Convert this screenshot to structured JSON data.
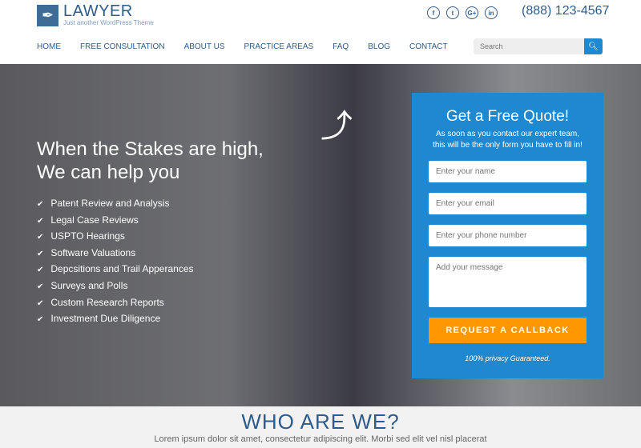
{
  "brand": {
    "title": "LAWYER",
    "tagline": "Just another WordPress Theme",
    "icon": "feather-icon"
  },
  "social": [
    {
      "icon": "facebook-icon",
      "glyph": "f"
    },
    {
      "icon": "twitter-icon",
      "glyph": "t"
    },
    {
      "icon": "google-plus-icon",
      "glyph": "G+"
    },
    {
      "icon": "linkedin-icon",
      "glyph": "in"
    }
  ],
  "phone": "(888) 123-4567",
  "nav": [
    "HOME",
    "FREE CONSULTATION",
    "ABOUT US",
    "PRACTICE AREAS",
    "FAQ",
    "BLOG",
    "CONTACT"
  ],
  "search": {
    "placeholder": "Search",
    "icon": "search-icon"
  },
  "hero": {
    "headline_1": "When the Stakes are high,",
    "headline_2": "We can help you",
    "list": [
      "Patent Review and Analysis",
      "Legal Case Reviews",
      "USPTO Hearings",
      "Software Valuations",
      "Depcsitions and Trail Apperances",
      "Surveys and Polls",
      "Custom Research Reports",
      "Investment Due Diligence"
    ]
  },
  "quote": {
    "title": "Get a Free Quote!",
    "sub_1": "As soon as you contact our expert team,",
    "sub_2": "this will be the only form you have to fill in!",
    "name_ph": "Enter your name",
    "email_ph": "Enter your email",
    "phone_ph": "Enter your phone number",
    "message_ph": "Add your message",
    "cta": "REQUEST A CALLBACK",
    "privacy": "100% privacy Guaranteed."
  },
  "who": {
    "title": "WHO ARE WE?",
    "text": "Lorem ipsum dolor sit amet, consectetur adipiscing elit. Morbi sed elit vel nisl placerat"
  },
  "colors": {
    "primary": "#2e5c8a",
    "accent": "#1e88d0",
    "cta": "#ff9800"
  }
}
